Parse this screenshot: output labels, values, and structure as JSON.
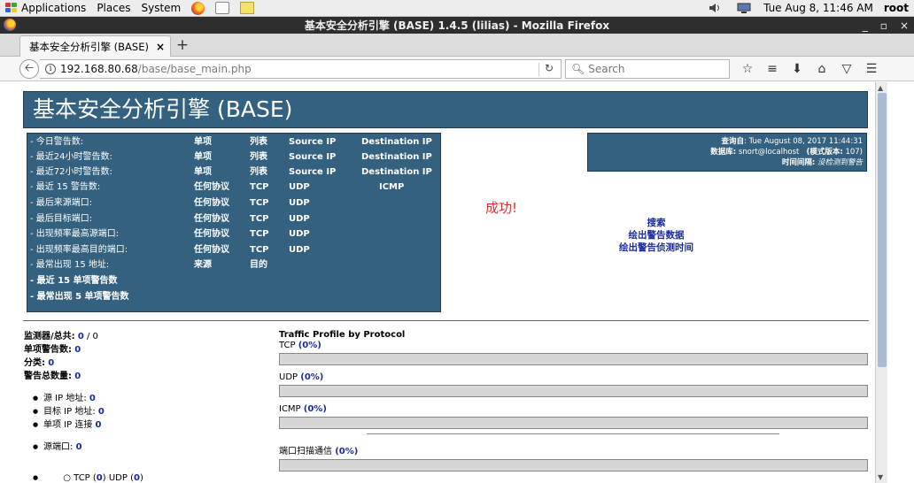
{
  "panel": {
    "applications": "Applications",
    "places": "Places",
    "system": "System",
    "datetime": "Tue Aug  8, 11:46 AM",
    "user": "root"
  },
  "window": {
    "title": "基本安全分析引擎 (BASE) 1.4.5 (lilias) - Mozilla Firefox",
    "min": "_",
    "max": "▫",
    "close": "×"
  },
  "tab": {
    "label": "基本安全分析引擎 (BASE) ...",
    "close": "×",
    "new_tab": "+"
  },
  "nav": {
    "url_host": "192.168.80.68",
    "url_path": "/base/base_main.php",
    "search_placeholder": "Search"
  },
  "page": {
    "header": "基本安全分析引擎 (BASE)",
    "success": "成功!",
    "menu": [
      {
        "label": "- 今日警告数:",
        "c1": "单项",
        "c2": "列表",
        "c3": "Source IP",
        "c4": "Destination IP"
      },
      {
        "label": "- 最近24小时警告数:",
        "c1": "单项",
        "c2": "列表",
        "c3": "Source IP",
        "c4": "Destination IP"
      },
      {
        "label": "- 最近72小时警告数:",
        "c1": "单项",
        "c2": "列表",
        "c3": "Source IP",
        "c4": "Destination IP"
      },
      {
        "label": "- 最近 15 警告数:",
        "c1": "任何协议",
        "c2": "TCP",
        "c3": "UDP",
        "c4": "ICMP"
      },
      {
        "label": "- 最后来源端口:",
        "c1": "任何协议",
        "c2": "TCP",
        "c3": "UDP"
      },
      {
        "label": "- 最后目标端口:",
        "c1": "任何协议",
        "c2": "TCP",
        "c3": "UDP"
      },
      {
        "label": "- 出现频率最高源端口:",
        "c1": "任何协议",
        "c2": "TCP",
        "c3": "UDP"
      },
      {
        "label": "- 出现频率最高目的端口:",
        "c1": "任何协议",
        "c2": "TCP",
        "c3": "UDP"
      },
      {
        "label": "- 最常出现 15 地址:",
        "c1": "来源",
        "c2": "目的"
      },
      {
        "label": "- 最近 15 单项警告数"
      },
      {
        "label": "- 最常出现 5 单项警告数"
      }
    ],
    "info": {
      "query_label": "查询自",
      "query_value": ": Tue August 08, 2017 11:44:31",
      "db_label": "数据库:",
      "db_value": " snort@localhost",
      "schema_label": "(模式版本:",
      "schema_value": " 107)",
      "time_label": "时间间隔:",
      "time_value": " 没检测到警告"
    },
    "links": [
      "搜索",
      "绘出警告数据",
      "绘出警告侦测时间"
    ],
    "stats": {
      "sensors_label": "监测器/总共:",
      "sensors_value": "0",
      "sensors_total": " / 0",
      "unique_label": "单项警告数:",
      "unique_value": "0",
      "categories_label": "分类:",
      "categories_value": "0",
      "total_label": "警告总数量:",
      "total_value": "0",
      "src_ip_label": "源 IP 地址:",
      "src_ip_value": "0",
      "dst_ip_label": "目标 IP 地址:",
      "dst_ip_value": "0",
      "unique_links_label": "单项 IP 连接",
      "unique_links_value": "0",
      "src_port_label": "源端口:",
      "src_port_value": "0",
      "tcp_label": "○ TCP (",
      "tcp_value": "0",
      "udp_label": ")  UDP (",
      "udp_value": "0",
      "close_paren": ")"
    },
    "traffic": {
      "title": "Traffic Profile by Protocol",
      "tcp_label": "TCP",
      "tcp_pct": "(0%)",
      "udp_label": "UDP",
      "udp_pct": "(0%)",
      "icmp_label": "ICMP",
      "icmp_pct": "(0%)",
      "portscan_label": "端口扫描通信",
      "portscan_pct": "(0%)",
      "tcp_fill": 0,
      "udp_fill": 0,
      "icmp_fill": 0,
      "portscan_fill": 0
    }
  },
  "colors": {
    "base_blue": "#33617f",
    "link_blue": "#1a2a9a",
    "success_red": "#e03030"
  }
}
